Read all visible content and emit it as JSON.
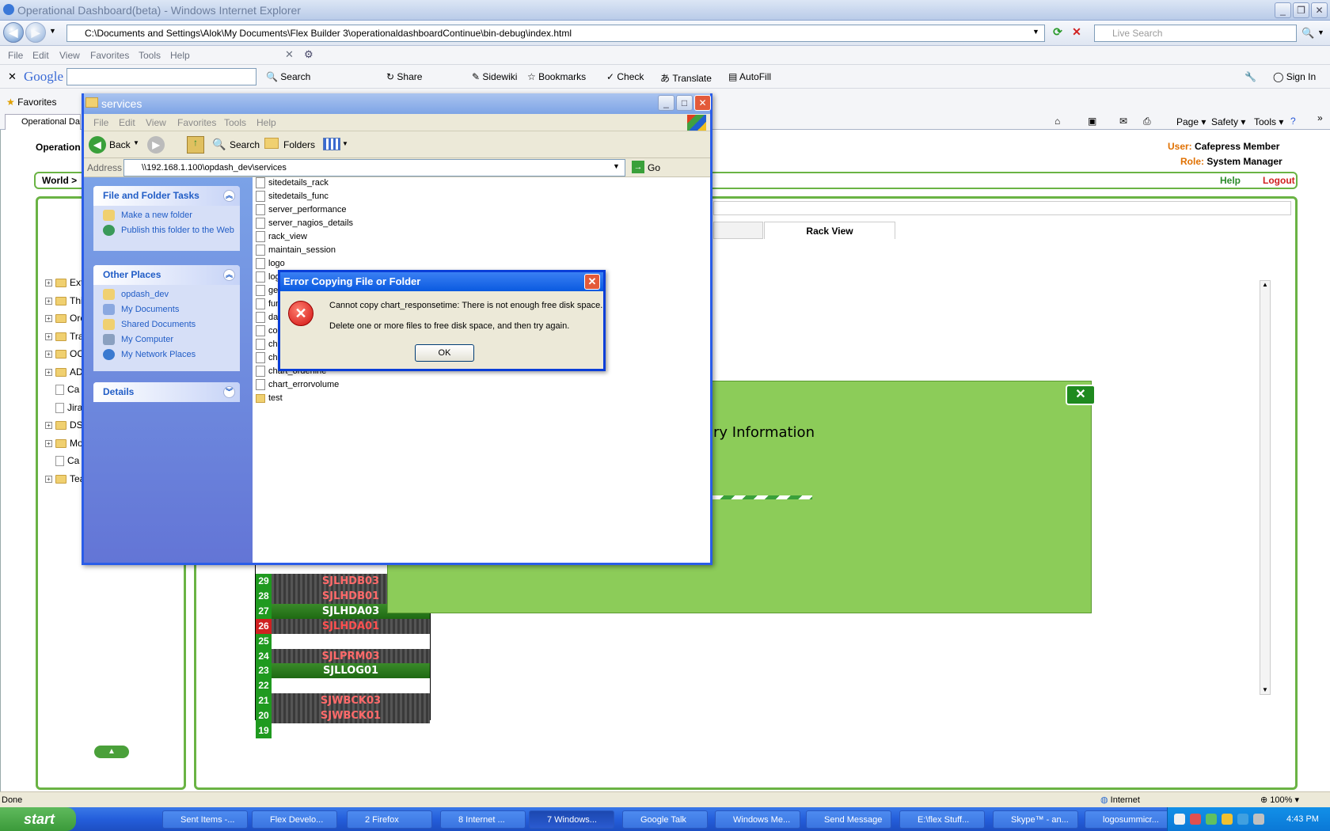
{
  "browser": {
    "title": "Operational Dashboard(beta) - Windows Internet Explorer",
    "address": "C:\\Documents and Settings\\Alok\\My Documents\\Flex Builder 3\\operationaldashboardContinue\\bin-debug\\index.html",
    "search_placeholder": "Live Search",
    "menu": [
      "File",
      "Edit",
      "View",
      "Favorites",
      "Tools",
      "Help"
    ],
    "google_toolbar": {
      "logo": "Google",
      "items": [
        "Search",
        "Share",
        "Sidewiki",
        "Bookmarks",
        "Check",
        "Translate",
        "AutoFill",
        "Sign In"
      ]
    },
    "favorites_label": "Favorites",
    "tab_label": "Operational Das",
    "command_bar": [
      "Page",
      "Safety",
      "Tools"
    ],
    "status_text": "Done",
    "zone": "Internet",
    "zoom": "100%"
  },
  "app": {
    "title": "Operation",
    "user_label": "User:",
    "user_value": "Cafepress Member",
    "role_label": "Role:",
    "role_value": "System Manager",
    "breadcrumb": "World >",
    "help": "Help",
    "logout": "Logout",
    "tab_rack_view": "Rack View",
    "popup_heading": "ory Information",
    "tree": [
      {
        "label": "Ext",
        "type": "folder"
      },
      {
        "label": "Thi",
        "type": "folder"
      },
      {
        "label": "Ore",
        "type": "folder"
      },
      {
        "label": "Tra",
        "type": "folder"
      },
      {
        "label": "OC",
        "type": "folder"
      },
      {
        "label": "AD",
        "type": "folder"
      },
      {
        "label": "Ca",
        "type": "doc"
      },
      {
        "label": "Jira",
        "type": "doc"
      },
      {
        "label": "DS",
        "type": "folder"
      },
      {
        "label": "Mo",
        "type": "folder"
      },
      {
        "label": "Ca",
        "type": "doc"
      },
      {
        "label": "Tea",
        "type": "folder"
      }
    ],
    "rack": [
      {
        "num": "29",
        "name": "SJLHDB03",
        "status": "ok"
      },
      {
        "num": "28",
        "name": "SJLHDB01",
        "status": "ok"
      },
      {
        "num": "27",
        "name": "SJLHDA03",
        "status": "ok"
      },
      {
        "num": "26",
        "name": "SJLHDA01",
        "status": "error"
      },
      {
        "num": "25",
        "name": "",
        "status": "ok"
      },
      {
        "num": "24",
        "name": "SJLPRM03",
        "status": "ok"
      },
      {
        "num": "23",
        "name": "SJLLOG01",
        "status": "ok"
      },
      {
        "num": "22",
        "name": "",
        "status": "ok"
      },
      {
        "num": "21",
        "name": "SJWBCK03",
        "status": "ok"
      },
      {
        "num": "20",
        "name": "SJWBCK01",
        "status": "ok"
      },
      {
        "num": "19",
        "name": "",
        "status": "ok"
      }
    ]
  },
  "explorer": {
    "title": "services",
    "menu": [
      "File",
      "Edit",
      "View",
      "Favorites",
      "Tools",
      "Help"
    ],
    "toolbar": {
      "back": "Back",
      "search": "Search",
      "folders": "Folders"
    },
    "address_label": "Address",
    "address": "\\\\192.168.1.100\\opdash_dev\\services",
    "go": "Go",
    "tasks_title": "File and Folder Tasks",
    "tasks": [
      "Make a new folder",
      "Publish this folder to the Web"
    ],
    "places_title": "Other Places",
    "places": [
      "opdash_dev",
      "My Documents",
      "Shared Documents",
      "My Computer",
      "My Network Places"
    ],
    "details_title": "Details",
    "files": [
      "sitedetails_rack",
      "sitedetails_func",
      "server_performance",
      "server_nagios_details",
      "rack_view",
      "maintain_session",
      "logo",
      "logi",
      "get",
      "fun",
      "dat",
      "coo",
      "cha",
      "cha",
      "chart_orderline",
      "chart_errorvolume",
      "test"
    ]
  },
  "error_dialog": {
    "title": "Error Copying File or Folder",
    "message": "Cannot copy chart_responsetime: There is not enough free disk space.",
    "hint": "Delete one or more files to free disk space, and then try again.",
    "ok": "OK"
  },
  "taskbar": {
    "start": "start",
    "buttons": [
      "Sent Items -...",
      "Flex Develo...",
      "2 Firefox",
      "8 Internet ...",
      "7 Windows...",
      "Google Talk",
      "Windows Me...",
      "Send Message",
      "E:\\flex Stuff...",
      "Skype™ - an...",
      "logosummicr..."
    ],
    "clock": "4:43 PM"
  }
}
